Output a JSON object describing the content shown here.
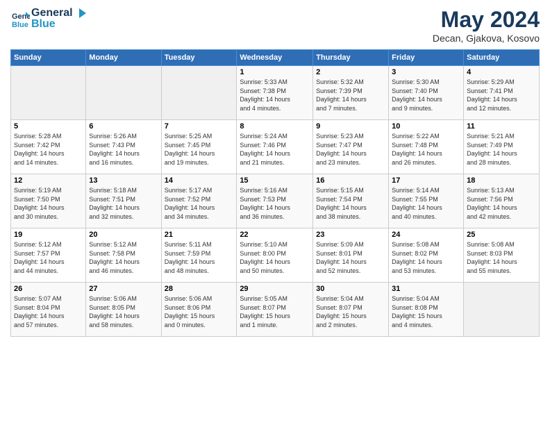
{
  "header": {
    "logo_line1": "General",
    "logo_line2": "Blue",
    "month_year": "May 2024",
    "location": "Decan, Gjakova, Kosovo"
  },
  "weekdays": [
    "Sunday",
    "Monday",
    "Tuesday",
    "Wednesday",
    "Thursday",
    "Friday",
    "Saturday"
  ],
  "weeks": [
    [
      {
        "day": "",
        "info": ""
      },
      {
        "day": "",
        "info": ""
      },
      {
        "day": "",
        "info": ""
      },
      {
        "day": "1",
        "info": "Sunrise: 5:33 AM\nSunset: 7:38 PM\nDaylight: 14 hours\nand 4 minutes."
      },
      {
        "day": "2",
        "info": "Sunrise: 5:32 AM\nSunset: 7:39 PM\nDaylight: 14 hours\nand 7 minutes."
      },
      {
        "day": "3",
        "info": "Sunrise: 5:30 AM\nSunset: 7:40 PM\nDaylight: 14 hours\nand 9 minutes."
      },
      {
        "day": "4",
        "info": "Sunrise: 5:29 AM\nSunset: 7:41 PM\nDaylight: 14 hours\nand 12 minutes."
      }
    ],
    [
      {
        "day": "5",
        "info": "Sunrise: 5:28 AM\nSunset: 7:42 PM\nDaylight: 14 hours\nand 14 minutes."
      },
      {
        "day": "6",
        "info": "Sunrise: 5:26 AM\nSunset: 7:43 PM\nDaylight: 14 hours\nand 16 minutes."
      },
      {
        "day": "7",
        "info": "Sunrise: 5:25 AM\nSunset: 7:45 PM\nDaylight: 14 hours\nand 19 minutes."
      },
      {
        "day": "8",
        "info": "Sunrise: 5:24 AM\nSunset: 7:46 PM\nDaylight: 14 hours\nand 21 minutes."
      },
      {
        "day": "9",
        "info": "Sunrise: 5:23 AM\nSunset: 7:47 PM\nDaylight: 14 hours\nand 23 minutes."
      },
      {
        "day": "10",
        "info": "Sunrise: 5:22 AM\nSunset: 7:48 PM\nDaylight: 14 hours\nand 26 minutes."
      },
      {
        "day": "11",
        "info": "Sunrise: 5:21 AM\nSunset: 7:49 PM\nDaylight: 14 hours\nand 28 minutes."
      }
    ],
    [
      {
        "day": "12",
        "info": "Sunrise: 5:19 AM\nSunset: 7:50 PM\nDaylight: 14 hours\nand 30 minutes."
      },
      {
        "day": "13",
        "info": "Sunrise: 5:18 AM\nSunset: 7:51 PM\nDaylight: 14 hours\nand 32 minutes."
      },
      {
        "day": "14",
        "info": "Sunrise: 5:17 AM\nSunset: 7:52 PM\nDaylight: 14 hours\nand 34 minutes."
      },
      {
        "day": "15",
        "info": "Sunrise: 5:16 AM\nSunset: 7:53 PM\nDaylight: 14 hours\nand 36 minutes."
      },
      {
        "day": "16",
        "info": "Sunrise: 5:15 AM\nSunset: 7:54 PM\nDaylight: 14 hours\nand 38 minutes."
      },
      {
        "day": "17",
        "info": "Sunrise: 5:14 AM\nSunset: 7:55 PM\nDaylight: 14 hours\nand 40 minutes."
      },
      {
        "day": "18",
        "info": "Sunrise: 5:13 AM\nSunset: 7:56 PM\nDaylight: 14 hours\nand 42 minutes."
      }
    ],
    [
      {
        "day": "19",
        "info": "Sunrise: 5:12 AM\nSunset: 7:57 PM\nDaylight: 14 hours\nand 44 minutes."
      },
      {
        "day": "20",
        "info": "Sunrise: 5:12 AM\nSunset: 7:58 PM\nDaylight: 14 hours\nand 46 minutes."
      },
      {
        "day": "21",
        "info": "Sunrise: 5:11 AM\nSunset: 7:59 PM\nDaylight: 14 hours\nand 48 minutes."
      },
      {
        "day": "22",
        "info": "Sunrise: 5:10 AM\nSunset: 8:00 PM\nDaylight: 14 hours\nand 50 minutes."
      },
      {
        "day": "23",
        "info": "Sunrise: 5:09 AM\nSunset: 8:01 PM\nDaylight: 14 hours\nand 52 minutes."
      },
      {
        "day": "24",
        "info": "Sunrise: 5:08 AM\nSunset: 8:02 PM\nDaylight: 14 hours\nand 53 minutes."
      },
      {
        "day": "25",
        "info": "Sunrise: 5:08 AM\nSunset: 8:03 PM\nDaylight: 14 hours\nand 55 minutes."
      }
    ],
    [
      {
        "day": "26",
        "info": "Sunrise: 5:07 AM\nSunset: 8:04 PM\nDaylight: 14 hours\nand 57 minutes."
      },
      {
        "day": "27",
        "info": "Sunrise: 5:06 AM\nSunset: 8:05 PM\nDaylight: 14 hours\nand 58 minutes."
      },
      {
        "day": "28",
        "info": "Sunrise: 5:06 AM\nSunset: 8:06 PM\nDaylight: 15 hours\nand 0 minutes."
      },
      {
        "day": "29",
        "info": "Sunrise: 5:05 AM\nSunset: 8:07 PM\nDaylight: 15 hours\nand 1 minute."
      },
      {
        "day": "30",
        "info": "Sunrise: 5:04 AM\nSunset: 8:07 PM\nDaylight: 15 hours\nand 2 minutes."
      },
      {
        "day": "31",
        "info": "Sunrise: 5:04 AM\nSunset: 8:08 PM\nDaylight: 15 hours\nand 4 minutes."
      },
      {
        "day": "",
        "info": ""
      }
    ]
  ]
}
